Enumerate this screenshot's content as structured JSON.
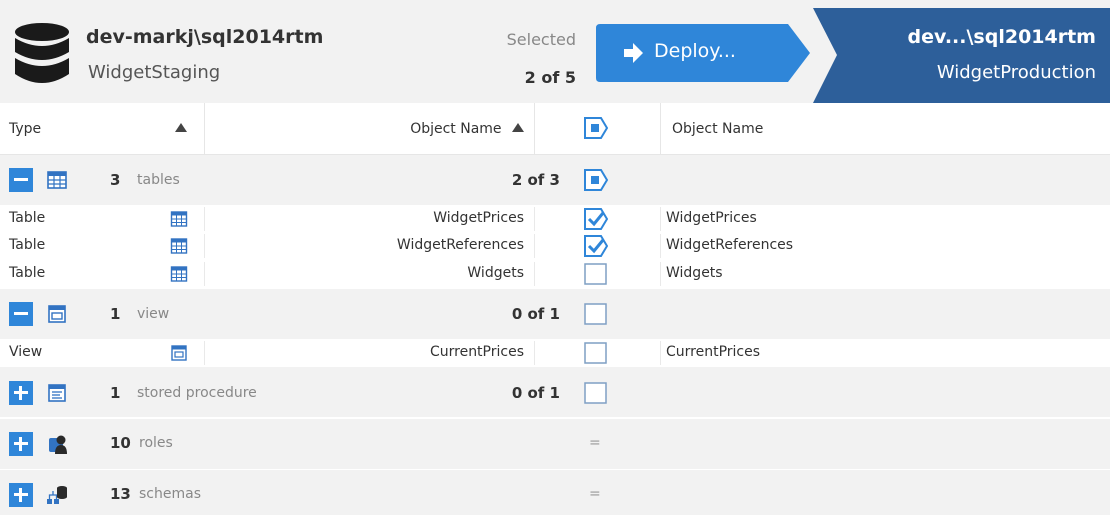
{
  "source": {
    "server": "dev-markj\\sql2014rtm",
    "database": "WidgetStaging"
  },
  "selection": {
    "label": "Selected",
    "count": "2 of 5"
  },
  "deploy": {
    "label": "Deploy..."
  },
  "target": {
    "server": "dev...\\sql2014rtm",
    "database": "WidgetProduction"
  },
  "columns": {
    "type": "Type",
    "object_name": "Object Name",
    "target_object_name": "Object Name"
  },
  "groups": [
    {
      "state": "expanded",
      "icon": "table-icon",
      "count": "3",
      "label": "tables",
      "selected": "2 of 3",
      "rows": [
        {
          "type": "Table",
          "name": "WidgetPrices",
          "target_name": "WidgetPrices",
          "checked": true
        },
        {
          "type": "Table",
          "name": "WidgetReferences",
          "target_name": "WidgetReferences",
          "checked": true
        },
        {
          "type": "Table",
          "name": "Widgets",
          "target_name": "Widgets",
          "checked": false
        }
      ]
    },
    {
      "state": "expanded",
      "icon": "view-icon",
      "count": "1",
      "label": "view",
      "selected": "0 of 1",
      "rows": [
        {
          "type": "View",
          "name": "CurrentPrices",
          "target_name": "CurrentPrices",
          "checked": false
        }
      ]
    },
    {
      "state": "collapsed",
      "icon": "stored-procedure-icon",
      "count": "1",
      "label": "stored procedure",
      "selected": "0 of 1"
    },
    {
      "state": "collapsed",
      "icon": "roles-icon",
      "count": "10",
      "label": "roles",
      "equal": "="
    },
    {
      "state": "collapsed",
      "icon": "schemas-icon",
      "count": "13",
      "label": "schemas",
      "equal": "="
    }
  ],
  "colors": {
    "accent": "#2f86d9",
    "target_band": "#2d5f9a",
    "header_bg": "#f2f2f2"
  }
}
